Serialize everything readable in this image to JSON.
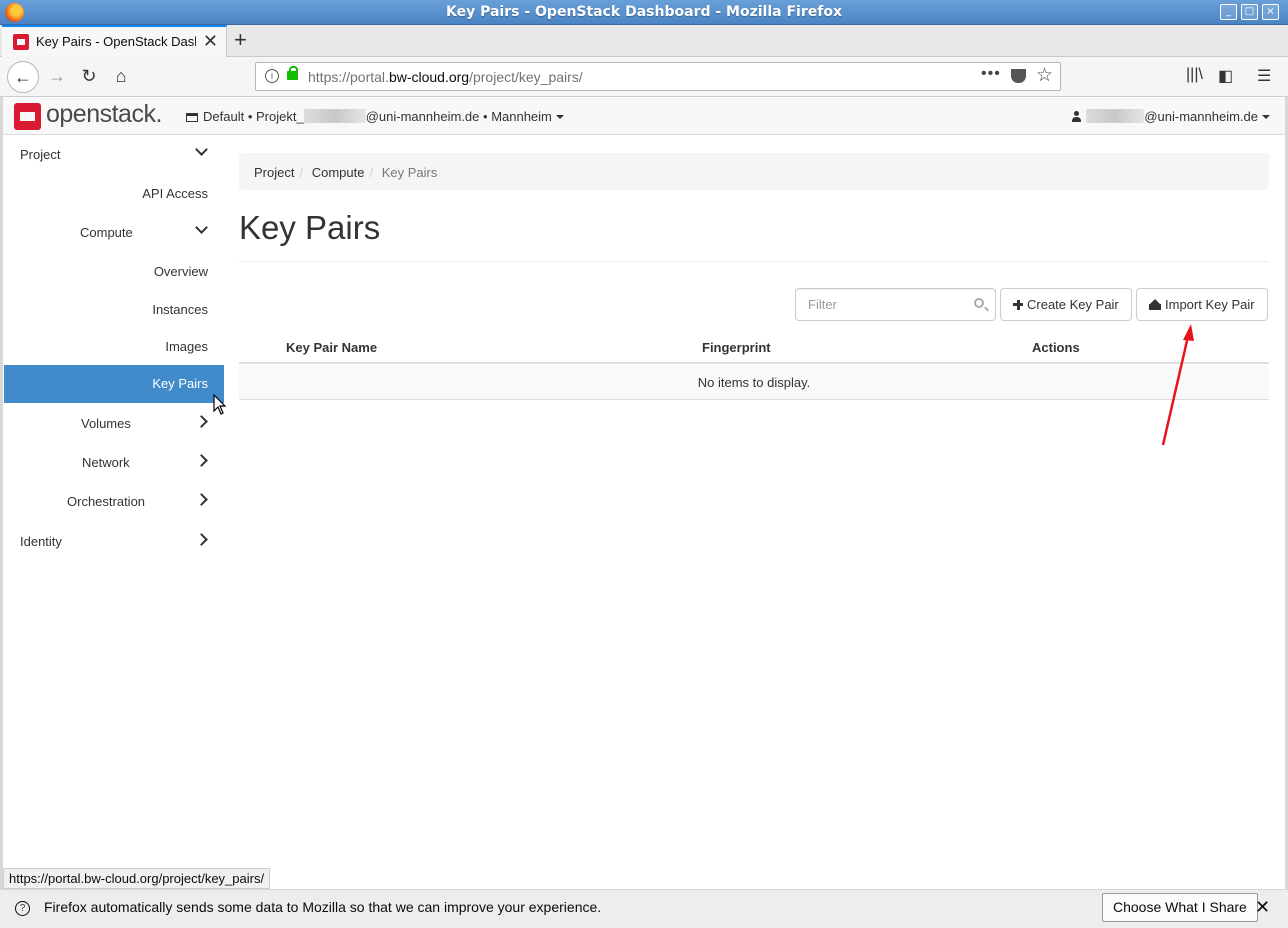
{
  "window": {
    "title": "Key Pairs - OpenStack Dashboard - Mozilla Firefox"
  },
  "browser": {
    "tab_label": "Key Pairs - OpenStack Dashboard",
    "url_prefix": "https://portal.",
    "url_domain": "bw-cloud.org",
    "url_path": "/project/key_pairs/",
    "status_url": "https://portal.bw-cloud.org/project/key_pairs/"
  },
  "header": {
    "logo_text": "openstack.",
    "context_domain": "Default",
    "context_project_prefix": "Projekt_",
    "context_project_suffix": "@uni-mannheim.de",
    "context_region": "Mannheim",
    "bullet": "•",
    "user_suffix": "@uni-mannheim.de"
  },
  "sidebar": {
    "project": "Project",
    "api_access": "API Access",
    "compute": "Compute",
    "overview": "Overview",
    "instances": "Instances",
    "images": "Images",
    "key_pairs": "Key Pairs",
    "volumes": "Volumes",
    "network": "Network",
    "orchestration": "Orchestration",
    "identity": "Identity"
  },
  "breadcrumb": {
    "items": [
      "Project",
      "Compute",
      "Key Pairs"
    ]
  },
  "page": {
    "title": "Key Pairs",
    "filter_placeholder": "Filter",
    "create_button": "Create Key Pair",
    "import_button": "Import Key Pair"
  },
  "table": {
    "columns": [
      "Key Pair Name",
      "Fingerprint",
      "Actions"
    ],
    "empty_message": "No items to display."
  },
  "notification": {
    "message": "Firefox automatically sends some data to Mozilla so that we can improve your experience.",
    "button": "Choose What I Share"
  },
  "colors": {
    "accent": "#428bca",
    "brand": "#da1a32",
    "annotation_arrow": "#e8141c"
  }
}
